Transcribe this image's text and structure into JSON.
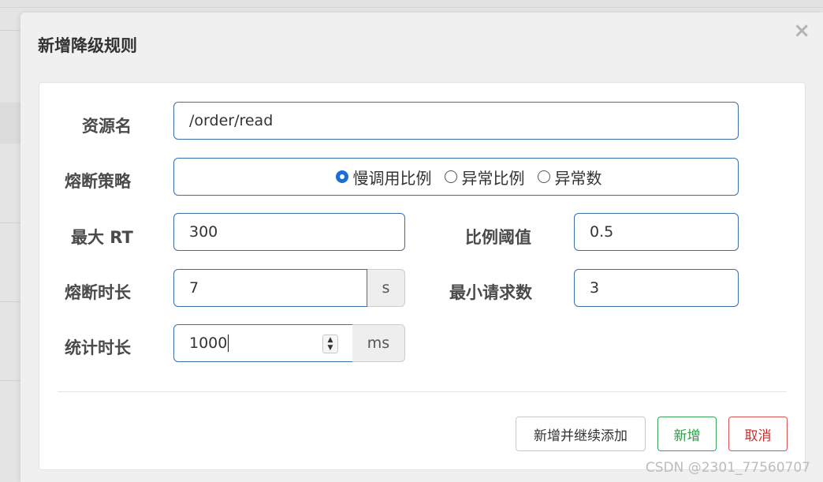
{
  "modal": {
    "title": "新增降级规则",
    "close_symbol": "×"
  },
  "form": {
    "resource": {
      "label": "资源名",
      "value": "/order/read"
    },
    "strategy": {
      "label": "熔断策略",
      "options": [
        "慢调用比例",
        "异常比例",
        "异常数"
      ],
      "selected": "慢调用比例"
    },
    "max_rt": {
      "label": "最大 RT",
      "value": "300"
    },
    "ratio_threshold": {
      "label": "比例阈值",
      "value": "0.5"
    },
    "break_duration": {
      "label": "熔断时长",
      "value": "7",
      "unit": "s"
    },
    "min_requests": {
      "label": "最小请求数",
      "value": "3"
    },
    "stat_duration": {
      "label": "统计时长",
      "value": "1000",
      "unit": "ms"
    }
  },
  "buttons": {
    "add_continue": "新增并继续添加",
    "add": "新增",
    "cancel": "取消"
  },
  "watermark": "CSDN @2301_77560707",
  "colors": {
    "input_border": "#3b6fa8",
    "radio_selected": "#1a6ed8",
    "success": "#2e9a4a",
    "danger": "#c9302c"
  }
}
